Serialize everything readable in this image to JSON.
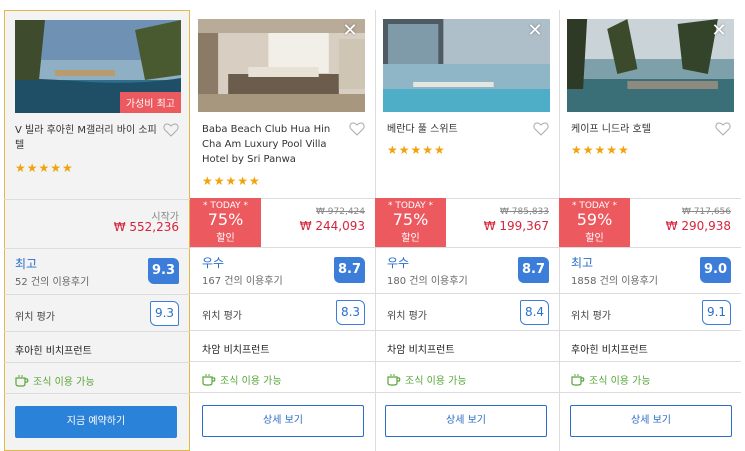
{
  "hotels": [
    {
      "name": "V 빌라 후아힌 M갤러리 바이 소피텔",
      "stars": "★★★★★",
      "badge": "가성비 최고",
      "price_label": "시작가",
      "price": "₩ 552,236",
      "review_label": "최고",
      "review_count": "52 건의 이용후기",
      "score": "9.3",
      "location_label": "위치 평가",
      "location_score": "9.3",
      "area": "후아힌 비치프런트",
      "breakfast": "조식 이용 가능",
      "button": "지금 예약하기"
    },
    {
      "name": "Baba Beach Club Hua Hin Cha Am Luxury Pool Villa Hotel by Sri Panwa",
      "stars": "★★★★★",
      "today_label": "* TODAY *",
      "discount": "75%",
      "discount_suffix": "할인",
      "old_price": "₩ 972,424",
      "price": "₩ 244,093",
      "review_label": "우수",
      "review_count": "167 건의 이용후기",
      "score": "8.7",
      "location_label": "위치 평가",
      "location_score": "8.3",
      "area": "차암 비치프런트",
      "breakfast": "조식 이용 가능",
      "button": "상세 보기"
    },
    {
      "name": "베란다 풀 스위트",
      "stars": "★★★★★",
      "today_label": "* TODAY *",
      "discount": "75%",
      "discount_suffix": "할인",
      "old_price": "₩ 785,833",
      "price": "₩ 199,367",
      "review_label": "우수",
      "review_count": "180 건의 이용후기",
      "score": "8.7",
      "location_label": "위치 평가",
      "location_score": "8.4",
      "area": "차암 비치프런트",
      "breakfast": "조식 이용 가능",
      "button": "상세 보기"
    },
    {
      "name": "케이프 니드라 호텔",
      "stars": "★★★★★",
      "today_label": "* TODAY *",
      "discount": "59%",
      "discount_suffix": "할인",
      "old_price": "₩ 717,656",
      "price": "₩ 290,938",
      "review_label": "최고",
      "review_count": "1858 건의 이용후기",
      "score": "9.0",
      "location_label": "위치 평가",
      "location_score": "9.1",
      "area": "후아힌 비치프런트",
      "breakfast": "조식 이용 가능",
      "button": "상세 보기"
    }
  ],
  "colors": {
    "accent_blue": "#3b7dd8",
    "price_red": "#d6243b",
    "deal_red": "#ec5a5f",
    "breakfast_green": "#58a63a",
    "star_orange": "#f0a30a"
  },
  "icons": {
    "close": "close-icon",
    "favorite": "heart-icon",
    "breakfast": "coffee-cup-icon"
  }
}
